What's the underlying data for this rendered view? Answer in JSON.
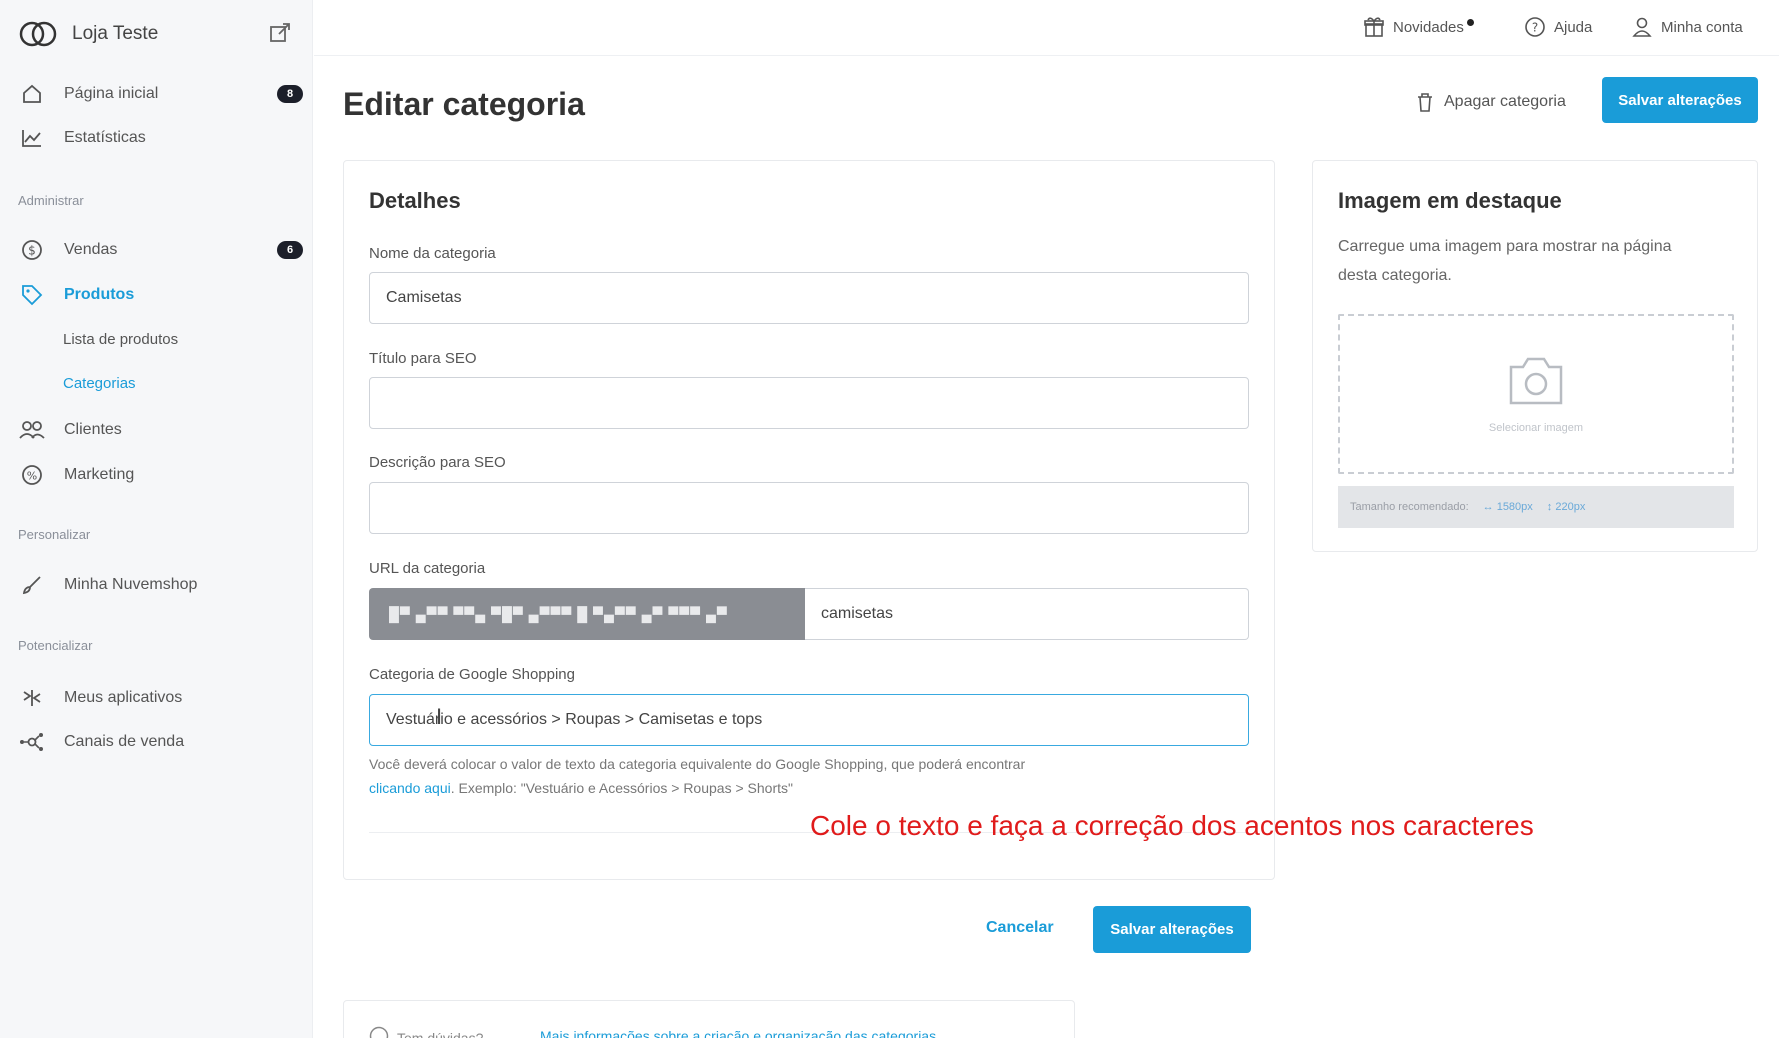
{
  "brand": {
    "name": "Loja Teste"
  },
  "sidebar": {
    "items": [
      {
        "label": "Página inicial",
        "badge": "8"
      },
      {
        "label": "Estatísticas"
      }
    ],
    "sections": {
      "administrar": "Administrar",
      "personalizar": "Personalizar",
      "potencializar": "Potencializar"
    },
    "admin_items": [
      {
        "label": "Vendas",
        "badge": "6"
      },
      {
        "label": "Produtos"
      },
      {
        "label": "Clientes"
      },
      {
        "label": "Marketing"
      }
    ],
    "product_sub": [
      {
        "label": "Lista de produtos"
      },
      {
        "label": "Categorias"
      }
    ],
    "custom_items": [
      {
        "label": "Minha Nuvemshop"
      }
    ],
    "power_items": [
      {
        "label": "Meus aplicativos"
      },
      {
        "label": "Canais de venda"
      }
    ]
  },
  "topbar": {
    "news": "Novidades",
    "help": "Ajuda",
    "account": "Minha conta"
  },
  "header": {
    "title": "Editar categoria",
    "delete": "Apagar categoria",
    "save": "Salvar alterações"
  },
  "details": {
    "title": "Detalhes",
    "name_label": "Nome da categoria",
    "name_value": "Camisetas",
    "seo_title_label": "Título para SEO",
    "seo_title_value": "",
    "seo_desc_label": "Descrição para SEO",
    "seo_desc_value": "",
    "url_label": "URL da categoria",
    "url_slug": "camisetas",
    "google_label": "Categoria de Google Shopping",
    "google_value": "Vestuário e acessórios > Roupas > Camisetas e tops",
    "help_text": "Você deverá colocar o valor de texto da categoria equivalente do Google Shopping, que poderá encontrar",
    "help_link": "clicando aqui",
    "help_example": ". Exemplo: \"Vestuário e Acessórios > Roupas > Shorts\""
  },
  "annotation": "Cole o texto e faça a correção dos acentos nos caracteres",
  "image_card": {
    "title": "Imagem em destaque",
    "description": "Carregue uma imagem para mostrar na página desta categoria.",
    "select": "Selecionar imagem",
    "recommended": "Tamanho recomendado:",
    "width": "↔ 1580px",
    "height": "↕ 220px"
  },
  "actions": {
    "cancel": "Cancelar",
    "save": "Salvar alterações"
  },
  "footer": {
    "help": "Tem dúvidas?",
    "link": "Mais informações sobre a criação e organização das categorias"
  },
  "colors": {
    "accent": "#1a9cd8",
    "annotation": "#e01b1b"
  }
}
